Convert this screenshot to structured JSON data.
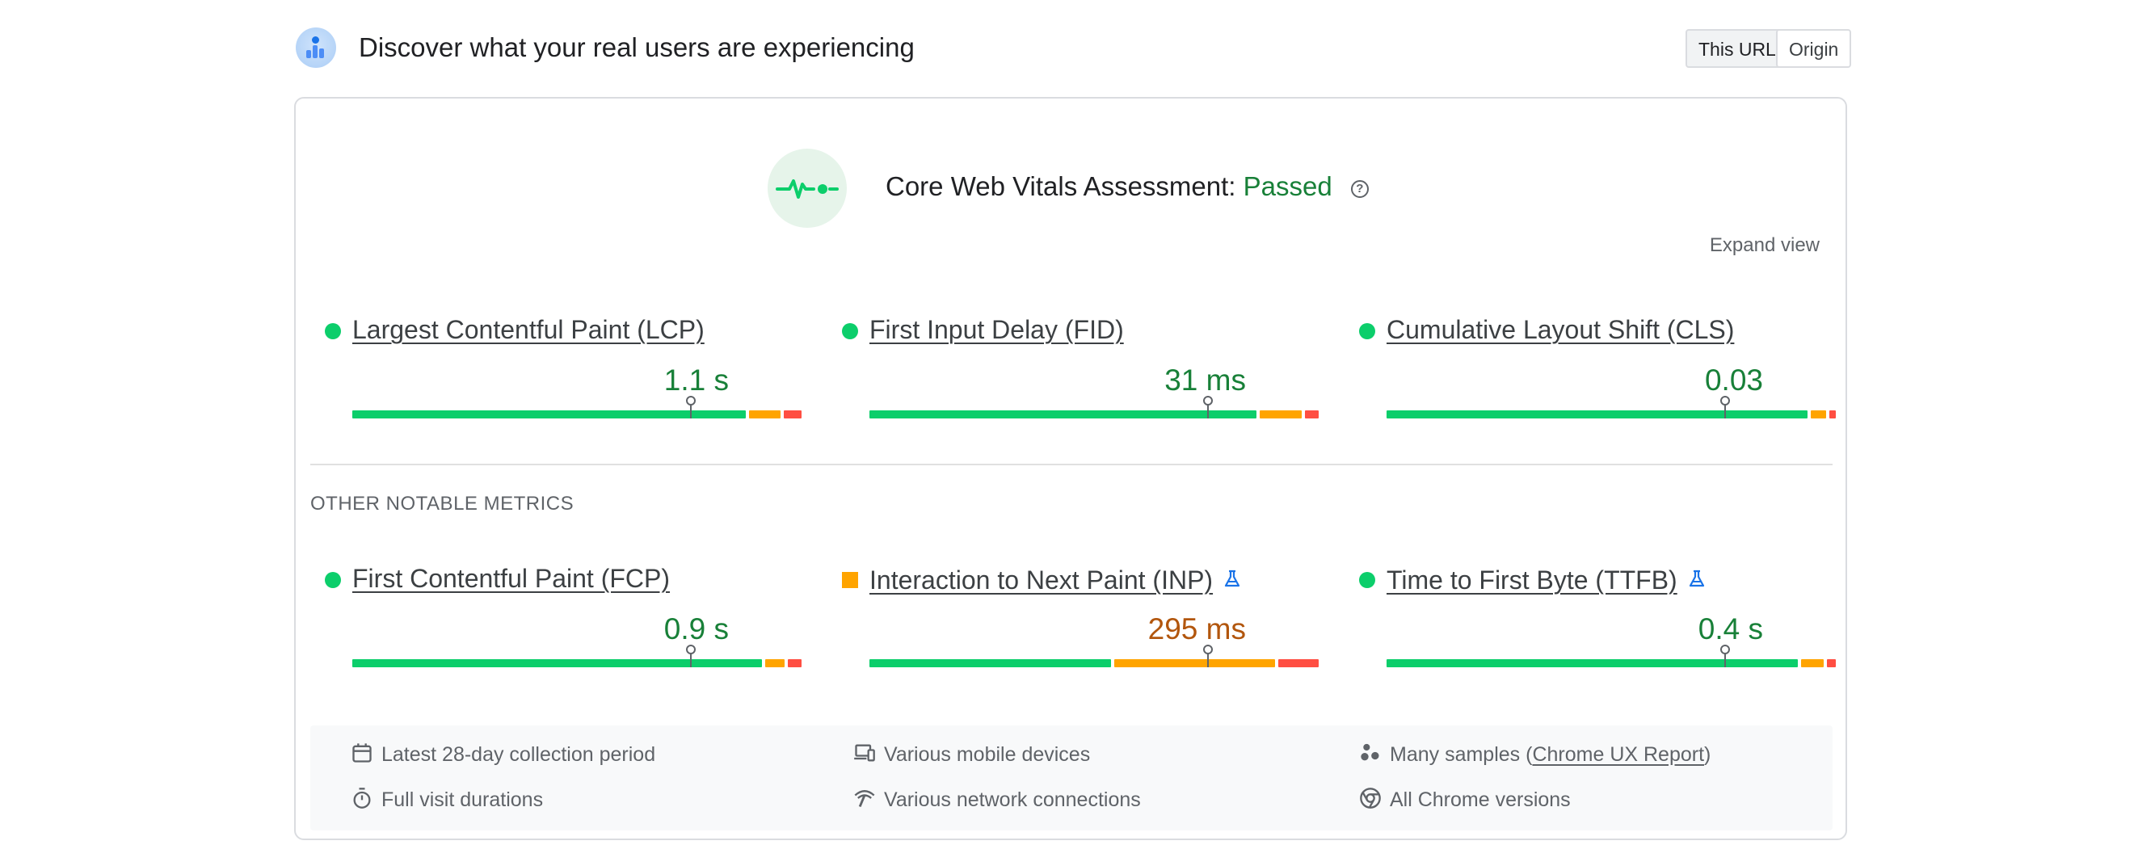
{
  "header": {
    "title": "Discover what your real users are experiencing",
    "toggle": {
      "this_url": "This URL",
      "origin": "Origin",
      "selected": "This URL"
    }
  },
  "assessment": {
    "label": "Core Web Vitals Assessment:",
    "status": "Passed",
    "help_icon": "help-circle-icon",
    "expand_label": "Expand view"
  },
  "core_metrics": [
    {
      "name": "Largest Contentful Paint (LCP)",
      "value": "1.1 s",
      "rating": "good",
      "distribution": {
        "good": 0.76,
        "needs_improvement": 0.06,
        "poor": 0.035
      },
      "marker": 0.755
    },
    {
      "name": "First Input Delay (FID)",
      "value": "31 ms",
      "rating": "good",
      "distribution": {
        "good": 0.87,
        "needs_improvement": 0.095,
        "poor": 0.03
      },
      "marker": 0.755
    },
    {
      "name": "Cumulative Layout Shift (CLS)",
      "value": "0.03",
      "rating": "good",
      "distribution": {
        "good": 0.95,
        "needs_improvement": 0.035,
        "poor": 0.015
      },
      "marker": 0.755
    }
  ],
  "other_section_label": "OTHER NOTABLE METRICS",
  "other_metrics": [
    {
      "name": "First Contentful Paint (FCP)",
      "value": "0.9 s",
      "rating": "good",
      "experimental": false,
      "distribution": {
        "good": 0.92,
        "needs_improvement": 0.045,
        "poor": 0.03
      },
      "marker": 0.755
    },
    {
      "name": "Interaction to Next Paint (INP)",
      "value": "295 ms",
      "rating": "needs-improvement",
      "experimental": true,
      "distribution": {
        "good": 0.54,
        "needs_improvement": 0.36,
        "poor": 0.09
      },
      "marker": 0.755
    },
    {
      "name": "Time to First Byte (TTFB)",
      "value": "0.4 s",
      "rating": "good",
      "experimental": true,
      "distribution": {
        "good": 0.92,
        "needs_improvement": 0.05,
        "poor": 0.02
      },
      "marker": 0.755
    }
  ],
  "footer": {
    "items": [
      {
        "icon": "calendar-icon",
        "text": "Latest 28-day collection period"
      },
      {
        "icon": "devices-icon",
        "text": "Various mobile devices"
      },
      {
        "icon": "samples-icon",
        "text_before": "Many samples (",
        "link": "Chrome UX Report",
        "text_after": ")"
      },
      {
        "icon": "timer-icon",
        "text": "Full visit durations"
      },
      {
        "icon": "network-icon",
        "text": "Various network connections"
      },
      {
        "icon": "chrome-icon",
        "text": "All Chrome versions"
      }
    ]
  },
  "colors": {
    "good": "#0cce6b",
    "needs_improvement": "#ffa400",
    "poor": "#ff4e42",
    "good_text": "#188038",
    "ni_text": "#b2560d"
  }
}
